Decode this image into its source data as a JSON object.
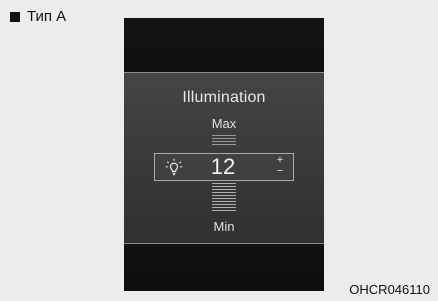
{
  "caption": {
    "label": "Тип А"
  },
  "display": {
    "title": "Illumination",
    "max_label": "Max",
    "min_label": "Min",
    "value": "12",
    "plus_label": "+",
    "minus_label": "−",
    "icon": "bulb-icon"
  },
  "figure_code": "OHCR046110",
  "colors": {
    "screen_background": "#121212",
    "panel_background": "#3a3a3a",
    "outline": "#a8a8a8",
    "text": "#e8e8e8"
  }
}
